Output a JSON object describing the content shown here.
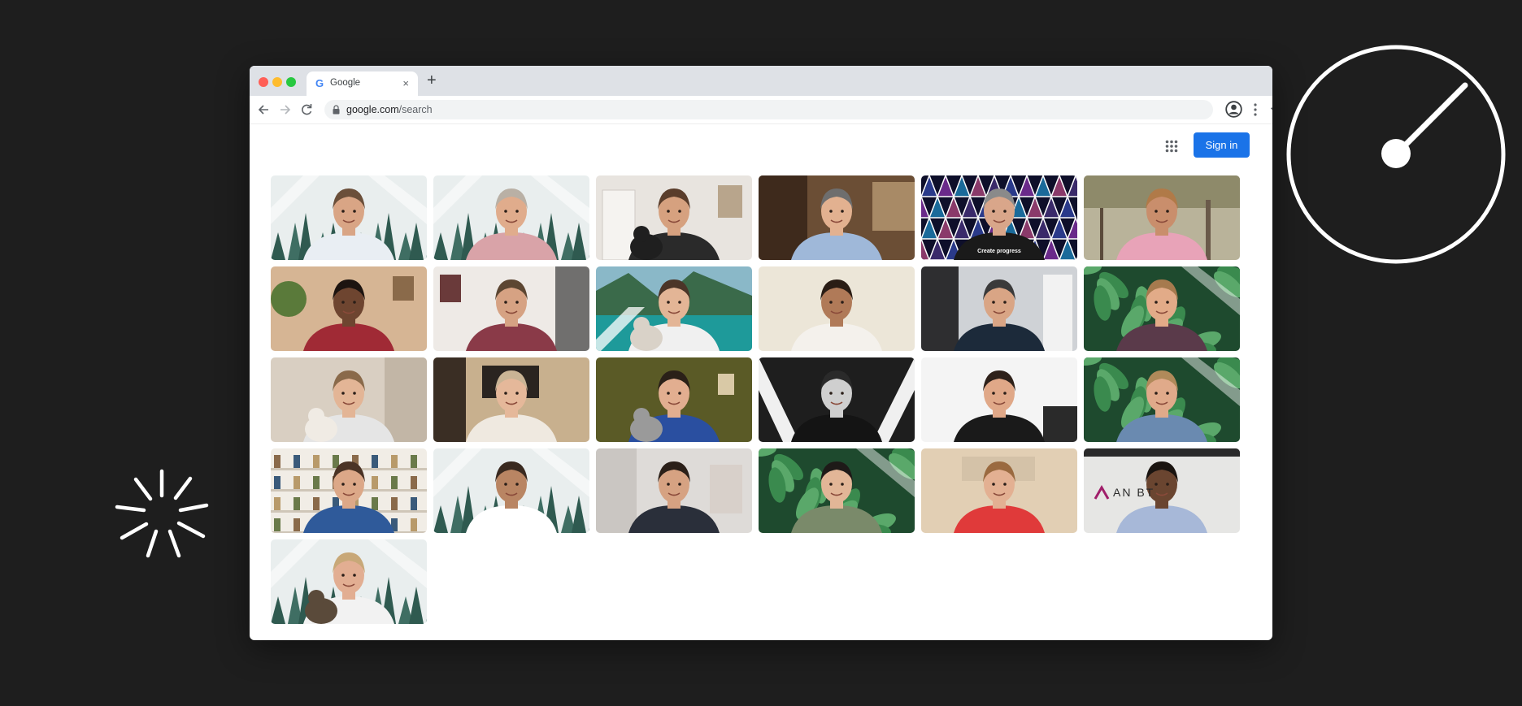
{
  "browser": {
    "tab_title": "Google",
    "tab_favicon": "G",
    "close_glyph": "×",
    "newtab_glyph": "+",
    "url_host": "google.com",
    "url_path": "/search"
  },
  "page": {
    "signin_label": "Sign in"
  },
  "colors": {
    "accent": "#1a73e8",
    "backdrop": "#1e1e1e"
  },
  "participants": [
    {
      "bg": "forest",
      "skin": "#d9a585",
      "hair": "#6b4f3a",
      "shirt": "#e9eef3"
    },
    {
      "bg": "forest",
      "skin": "#e0ac8c",
      "hair": "#b9b0a5",
      "shirt": "#d9a3a8"
    },
    {
      "bg": "room",
      "skin": "#d6a17f",
      "hair": "#5a3d2b",
      "shirt": "#2a2a2a",
      "pet": "#1f1f1f"
    },
    {
      "bg": "office",
      "skin": "#e2b190",
      "hair": "#6e6e6e",
      "shirt": "#9fb8d9"
    },
    {
      "bg": "galaxy",
      "skin": "#d9a68a",
      "hair": "#8a8a8a",
      "shirt": "#1a1a1a",
      "caption": "Create progress"
    },
    {
      "bg": "garden",
      "skin": "#c98e6c",
      "hair": "#b07a48",
      "shirt": "#e8a3b8"
    },
    {
      "bg": "homewarm",
      "skin": "#6e4530",
      "hair": "#1d1410",
      "shirt": "#a02a35"
    },
    {
      "bg": "whiteroom",
      "skin": "#d6a283",
      "hair": "#5c4632",
      "shirt": "#8a3a48"
    },
    {
      "bg": "lake",
      "skin": "#e3b596",
      "hair": "#4b3528",
      "shirt": "#f0f0f0",
      "pet": "#d9d2c8"
    },
    {
      "bg": "beige",
      "skin": "#b07a58",
      "hair": "#2a1d15",
      "shirt": "#f4f1ec"
    },
    {
      "bg": "shelves",
      "skin": "#d9a585",
      "hair": "#3a3a3a",
      "shirt": "#1c2a3a"
    },
    {
      "bg": "leaves",
      "skin": "#e2ab88",
      "hair": "#a67a4e",
      "shirt": "#5a3a4a"
    },
    {
      "bg": "cream",
      "skin": "#e3b596",
      "hair": "#8a6a4a",
      "shirt": "#e5e5e5",
      "pet": "#f0ebe4"
    },
    {
      "bg": "cozy",
      "skin": "#e5b89a",
      "hair": "#c9b495",
      "shirt": "#efe9e0"
    },
    {
      "bg": "olive",
      "skin": "#e2ae90",
      "hair": "#2a2018",
      "shirt": "#2a4fa0",
      "pet": "#9a9a9a"
    },
    {
      "bg": "mono",
      "skin": "#cfcfcf",
      "hair": "#2a2a2a",
      "shirt": "#141414"
    },
    {
      "bg": "whitewall",
      "skin": "#e0a888",
      "hair": "#2e211a",
      "shirt": "#1a1a1a"
    },
    {
      "bg": "leaves",
      "skin": "#e0aa8a",
      "hair": "#b08a5a",
      "shirt": "#6a8ab0"
    },
    {
      "bg": "bookcase",
      "skin": "#dca888",
      "hair": "#4a3325",
      "shirt": "#2f5a9a"
    },
    {
      "bg": "forest",
      "skin": "#b98563",
      "hair": "#3a2a20",
      "shirt": "#ffffff"
    },
    {
      "bg": "blurwhite",
      "skin": "#d6a282",
      "hair": "#2a1f18",
      "shirt": "#2a2f3a"
    },
    {
      "bg": "leaves",
      "skin": "#e2b697",
      "hair": "#1e1a18",
      "shirt": "#7a8a6a"
    },
    {
      "bg": "warmwall",
      "skin": "#e3b092",
      "hair": "#9a6a40",
      "shirt": "#e03a3a"
    },
    {
      "bg": "brandwall",
      "skin": "#6a4530",
      "hair": "#1a1410",
      "shirt": "#a7b8d8",
      "wall_text": "AN BT"
    },
    {
      "bg": "forest",
      "skin": "#e2ae92",
      "hair": "#c8a878",
      "shirt": "#f2f2f2",
      "pet": "#5a4a3a"
    }
  ]
}
